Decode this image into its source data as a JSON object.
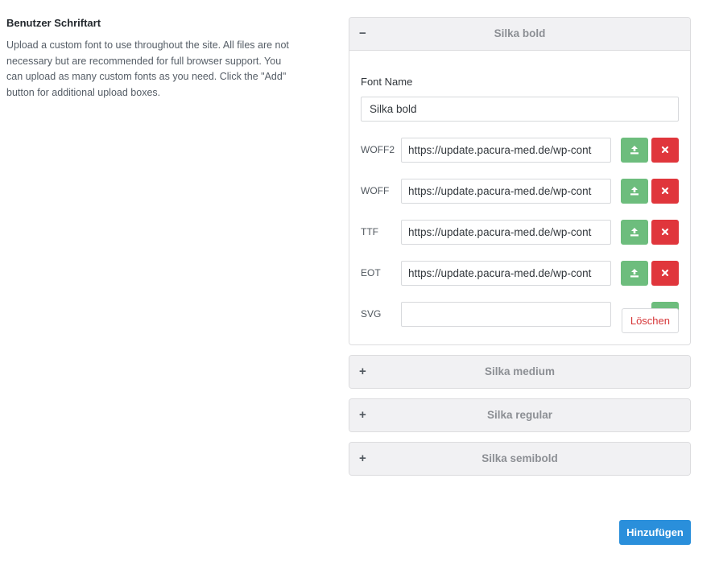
{
  "section": {
    "title": "Benutzer Schriftart",
    "description": "Upload a custom font to use throughout the site. All files are not necessary but are recommended for full browser support. You can upload as many custom fonts as you need. Click the \"Add\" button for additional upload boxes."
  },
  "fonts": [
    {
      "title": "Silka bold",
      "toggle": "−",
      "expanded": true,
      "font_name_label": "Font Name",
      "font_name_value": "Silka bold",
      "files": [
        {
          "label": "WOFF2",
          "value": "https://update.pacura-med.de/wp-cont"
        },
        {
          "label": "WOFF",
          "value": "https://update.pacura-med.de/wp-cont"
        },
        {
          "label": "TTF",
          "value": "https://update.pacura-med.de/wp-cont"
        },
        {
          "label": "EOT",
          "value": "https://update.pacura-med.de/wp-cont"
        },
        {
          "label": "SVG",
          "value": ""
        }
      ],
      "delete_label": "Löschen"
    },
    {
      "title": "Silka medium",
      "toggle": "+",
      "expanded": false
    },
    {
      "title": "Silka regular",
      "toggle": "+",
      "expanded": false
    },
    {
      "title": "Silka semibold",
      "toggle": "+",
      "expanded": false
    }
  ],
  "add_button_label": "Hinzufügen",
  "icons": {
    "upload": "upload-icon",
    "remove": "close-icon"
  },
  "colors": {
    "upload_button": "#6dbd7d",
    "remove_button": "#e0363c",
    "add_button": "#2a8fdb",
    "delete_text": "#d63638"
  }
}
